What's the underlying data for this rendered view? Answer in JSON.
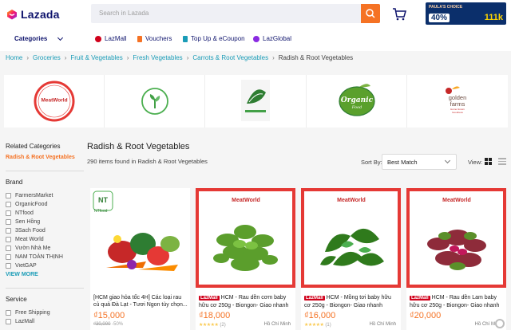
{
  "header": {
    "logo_text": "Lazada",
    "search_placeholder": "Search in Lazada",
    "promo": {
      "top_text": "PAULA'S CHOICE",
      "discount": "40%",
      "right_value": "111k"
    }
  },
  "nav": {
    "categories_label": "Categories",
    "links": [
      "LazMall",
      "Vouchers",
      "Top Up & eCoupon",
      "LazGlobal"
    ]
  },
  "breadcrumb": [
    "Home",
    "Groceries",
    "Fruit & Vegetables",
    "Fresh Vegetables",
    "Carrots & Root Vegetables",
    "Radish & Root Vegetables"
  ],
  "brands": [
    {
      "name": "Meat World"
    },
    {
      "name": "leaf-logo"
    },
    {
      "name": "farm-logo"
    },
    {
      "name": "Organic Food"
    },
    {
      "name": "golden farms",
      "tagline": "Home Grown Goodness"
    }
  ],
  "sidebar": {
    "related_title": "Related Categories",
    "related_selected": "Radish & Root Vegetables",
    "brand_title": "Brand",
    "brands": [
      "FarmersMarket",
      "OrganicFood",
      "NTfood",
      "Sen Hồng",
      "3Sach Food",
      "Meat World",
      "Vườn Nhà Mẹ",
      "NAM TOÀN THỊNH",
      "VietGAP"
    ],
    "view_more": "VIEW MORE",
    "service_title": "Service",
    "services": [
      "Free Shipping",
      "LazMall"
    ]
  },
  "main": {
    "title": "Radish & Root Vegetables",
    "count_text": "290 items found in Radish & Root Vegetables",
    "sort_label": "Sort By:",
    "sort_value": "Best Match",
    "view_label": "View:"
  },
  "products": [
    {
      "badge": "",
      "name": "[HCM giao hỏa tốc 4H] Các loại rau củ quả Đà Lạt - Tươi Ngon tùy chọn...",
      "price": "₫15,000",
      "original_price": "₫30,000",
      "discount": "-50%",
      "rating_count": "",
      "location": ""
    },
    {
      "badge": "LazMall",
      "name": "HCM - Rau dền cơm baby hữu cơ 250g - Biongon- Giao nhanh",
      "price": "₫18,000",
      "original_price": "",
      "discount": "",
      "rating_count": "(2)",
      "location": "Hồ Chí Minh"
    },
    {
      "badge": "LazMall",
      "name": "HCM - Mồng tơi baby hữu cơ 250g - Biongon- Giao nhanh",
      "price": "₫16,000",
      "original_price": "",
      "discount": "",
      "rating_count": "(1)",
      "location": "Hồ Chí Minh"
    },
    {
      "badge": "LazMall",
      "name": "HCM - Rau dền Lam baby hữu cơ 250g - Biongon- Giao nhanh",
      "price": "₫20,000",
      "original_price": "",
      "discount": "",
      "rating_count": "",
      "location": "Hồ Chí Minh"
    }
  ],
  "brand_label_nt": "NTfood",
  "frame_brand": "MeatWorld",
  "colors": {
    "accent": "#f57224",
    "brand_navy": "#0f146d",
    "link": "#1a9cb7",
    "lazmall_red": "#d0011b"
  }
}
